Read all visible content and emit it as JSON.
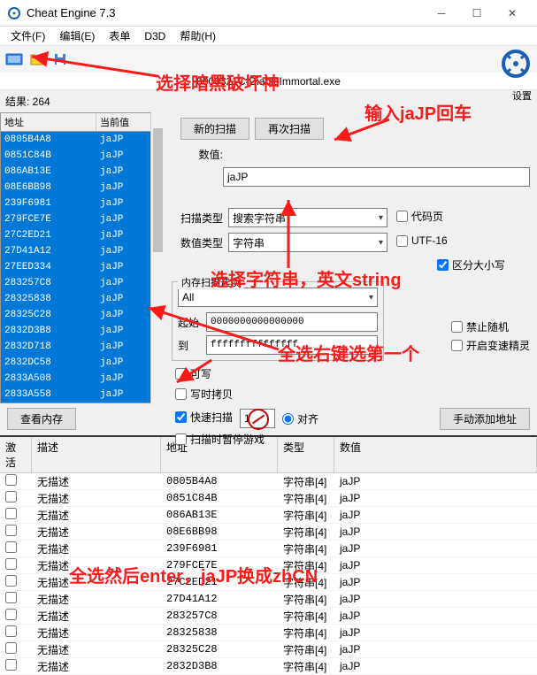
{
  "title": "Cheat Engine 7.3",
  "menu": {
    "file": "文件(F)",
    "edit": "编辑(E)",
    "table": "表单",
    "d3d": "D3D",
    "help": "帮助(H)"
  },
  "process": "0000321C-DiabloImmortal.exe",
  "settings_label": "设置",
  "results_label": "结果: 264",
  "left_cols": {
    "addr": "地址",
    "cur": "当前值"
  },
  "addresses": [
    {
      "addr": "0805B4A8",
      "val": "jaJP"
    },
    {
      "addr": "0851C84B",
      "val": "jaJP"
    },
    {
      "addr": "086AB13E",
      "val": "jaJP"
    },
    {
      "addr": "08E6BB98",
      "val": "jaJP"
    },
    {
      "addr": "239F6981",
      "val": "jaJP"
    },
    {
      "addr": "279FCE7E",
      "val": "jaJP"
    },
    {
      "addr": "27C2ED21",
      "val": "jaJP"
    },
    {
      "addr": "27D41A12",
      "val": "jaJP"
    },
    {
      "addr": "27EED334",
      "val": "jaJP"
    },
    {
      "addr": "283257C8",
      "val": "jaJP"
    },
    {
      "addr": "28325838",
      "val": "jaJP"
    },
    {
      "addr": "28325C28",
      "val": "jaJP"
    },
    {
      "addr": "2832D3B8",
      "val": "jaJP"
    },
    {
      "addr": "2832D718",
      "val": "jaJP"
    },
    {
      "addr": "2832DC58",
      "val": "jaJP"
    },
    {
      "addr": "2833A508",
      "val": "jaJP"
    },
    {
      "addr": "2833A558",
      "val": "jaJP"
    }
  ],
  "btns": {
    "new_scan": "新的扫描",
    "next_scan": "再次扫描",
    "view_mem": "查看内存",
    "manual_add": "手动添加地址"
  },
  "labels": {
    "value": "数值:",
    "scan_type": "扫描类型",
    "value_type": "数值类型",
    "mem_scan_opts": "内存扫描选项",
    "start": "起始",
    "to": "到",
    "writable": "可写",
    "cow": "写时拷贝",
    "fast_scan": "快速扫描",
    "align": "对齐",
    "pause_on_scan": "扫描时暂停游戏",
    "codepage": "代码页",
    "utf16": "UTF-16",
    "case_sensitive": "区分大小写",
    "no_random": "禁止随机",
    "open_speedhack": "开启变速精灵"
  },
  "values": {
    "search_value": "jaJP",
    "scan_type": "搜索字符串",
    "value_type": "字符串",
    "mem_range": "All",
    "start_addr": "0000000000000000",
    "end_addr": "fffffffffffffff",
    "align_val": "1"
  },
  "checks": {
    "codepage": false,
    "utf16": false,
    "case_sensitive": true,
    "no_random": false,
    "open_speedhack": false
  },
  "bottom_cols": {
    "act": "激活",
    "desc": "描述",
    "addr": "地址",
    "type": "类型",
    "val": "数值"
  },
  "bottom_rows": [
    {
      "desc": "无描述",
      "addr": "0805B4A8",
      "type": "字符串[4]",
      "val": "jaJP"
    },
    {
      "desc": "无描述",
      "addr": "0851C84B",
      "type": "字符串[4]",
      "val": "jaJP"
    },
    {
      "desc": "无描述",
      "addr": "086AB13E",
      "type": "字符串[4]",
      "val": "jaJP"
    },
    {
      "desc": "无描述",
      "addr": "08E6BB98",
      "type": "字符串[4]",
      "val": "jaJP"
    },
    {
      "desc": "无描述",
      "addr": "239F6981",
      "type": "字符串[4]",
      "val": "jaJP"
    },
    {
      "desc": "无描述",
      "addr": "279FCE7E",
      "type": "字符串[4]",
      "val": "jaJP"
    },
    {
      "desc": "无描述",
      "addr": "27C2ED21",
      "type": "字符串[4]",
      "val": "jaJP"
    },
    {
      "desc": "无描述",
      "addr": "27D41A12",
      "type": "字符串[4]",
      "val": "jaJP"
    },
    {
      "desc": "无描述",
      "addr": "283257C8",
      "type": "字符串[4]",
      "val": "jaJP"
    },
    {
      "desc": "无描述",
      "addr": "28325838",
      "type": "字符串[4]",
      "val": "jaJP"
    },
    {
      "desc": "无描述",
      "addr": "28325C28",
      "type": "字符串[4]",
      "val": "jaJP"
    },
    {
      "desc": "无描述",
      "addr": "2832D3B8",
      "type": "字符串[4]",
      "val": "jaJP"
    }
  ],
  "annotations": {
    "a1": "选择暗黑破坏神",
    "a2": "输入jaJP回车",
    "a3": "选择字符串，英文string",
    "a4": "全选右键选第一个",
    "a5": "全选然后enter，jaJP换成zhCN"
  }
}
